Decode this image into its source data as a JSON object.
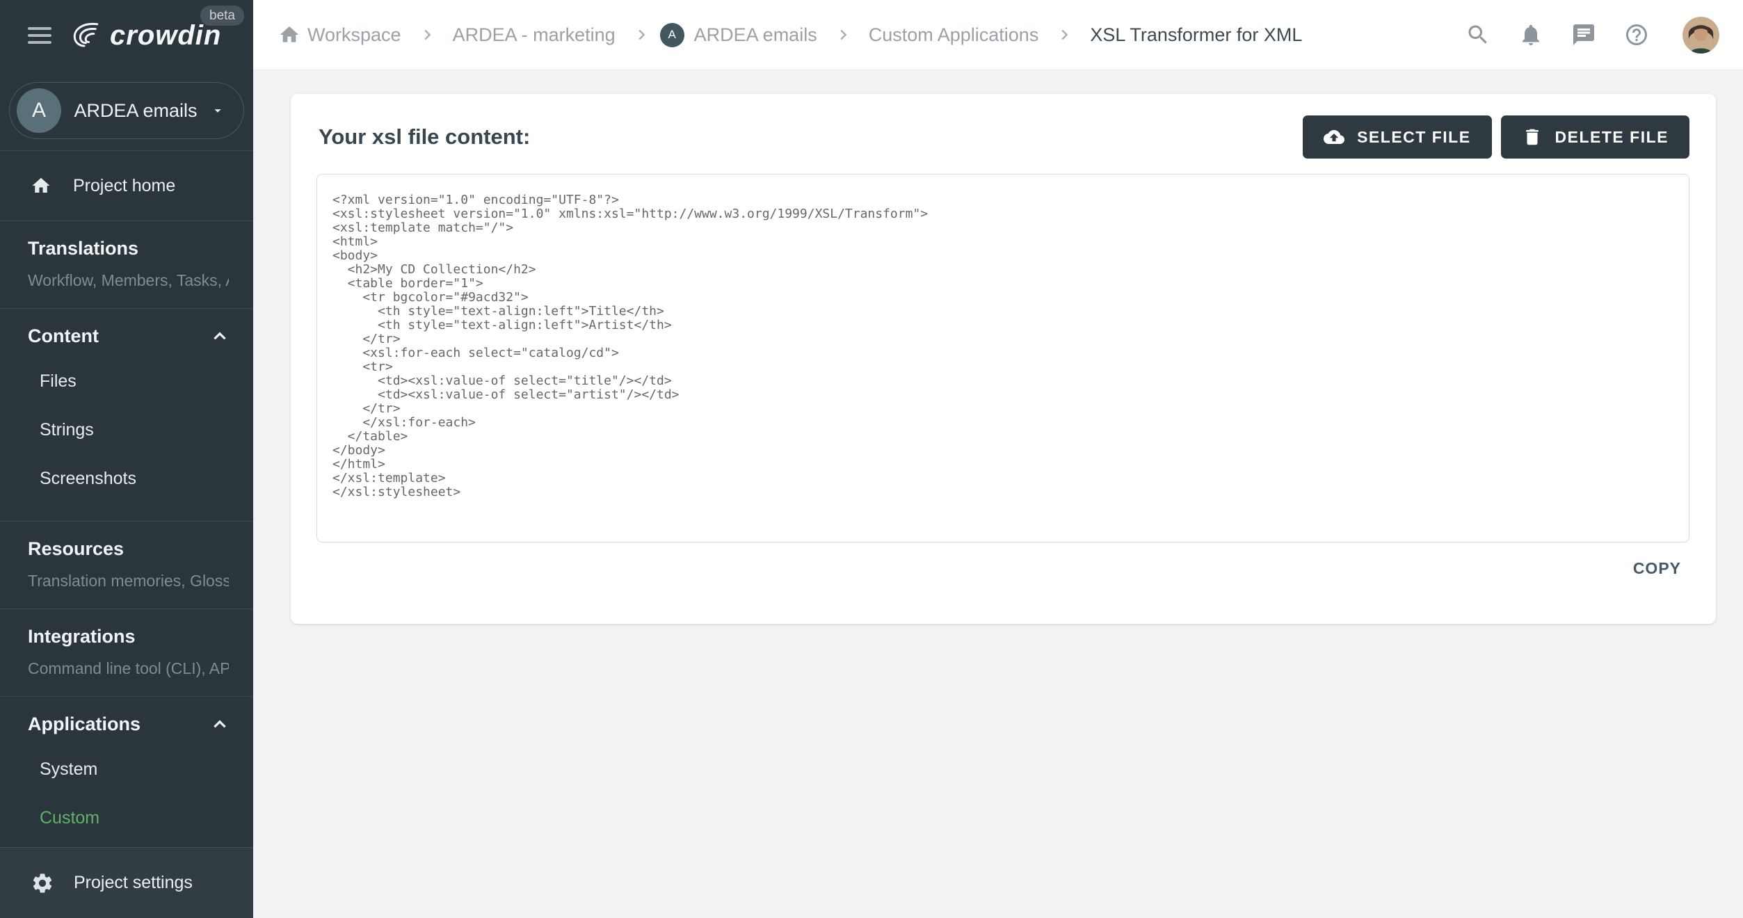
{
  "topbar": {
    "logo_text": "crowdin",
    "beta_label": "beta",
    "breadcrumb": {
      "workspace": "Workspace",
      "org": "ARDEA - marketing",
      "project": "ARDEA emails",
      "project_avatar_letter": "A",
      "apps": "Custom Applications",
      "current": "XSL Transformer for XML"
    }
  },
  "sidebar": {
    "project": {
      "avatar_letter": "A",
      "name": "ARDEA emails"
    },
    "home_label": "Project home",
    "sections": {
      "translations": {
        "title": "Translations",
        "subtitle": "Workflow, Members, Tasks, Act…"
      },
      "content": {
        "title": "Content",
        "items": {
          "files": "Files",
          "strings": "Strings",
          "screenshots": "Screenshots"
        }
      },
      "resources": {
        "title": "Resources",
        "subtitle": "Translation memories, Glossari…"
      },
      "integrations": {
        "title": "Integrations",
        "subtitle": "Command line tool (CLI), API, A…"
      },
      "applications": {
        "title": "Applications",
        "items": {
          "system": "System",
          "custom": "Custom"
        }
      }
    },
    "footer_label": "Project settings",
    "active_item": "Custom",
    "active_color": "#5db469"
  },
  "main": {
    "heading": "Your xsl file content:",
    "select_file_label": "SELECT FILE",
    "delete_file_label": "DELETE FILE",
    "copy_label": "COPY",
    "code": "<?xml version=\"1.0\" encoding=\"UTF-8\"?>\n<xsl:stylesheet version=\"1.0\" xmlns:xsl=\"http://www.w3.org/1999/XSL/Transform\">\n<xsl:template match=\"/\">\n<html>\n<body>\n  <h2>My CD Collection</h2>\n  <table border=\"1\">\n    <tr bgcolor=\"#9acd32\">\n      <th style=\"text-align:left\">Title</th>\n      <th style=\"text-align:left\">Artist</th>\n    </tr>\n    <xsl:for-each select=\"catalog/cd\">\n    <tr>\n      <td><xsl:value-of select=\"title\"/></td>\n      <td><xsl:value-of select=\"artist\"/></td>\n    </tr>\n    </xsl:for-each>\n  </table>\n</body>\n</html>\n</xsl:template>\n</xsl:stylesheet>"
  },
  "colors": {
    "sidebar_bg": "#2b363c",
    "footer_bg": "#313d43",
    "accent_green": "#5db469",
    "button_dark": "#2e3a40",
    "page_bg": "#f2f3f5"
  }
}
